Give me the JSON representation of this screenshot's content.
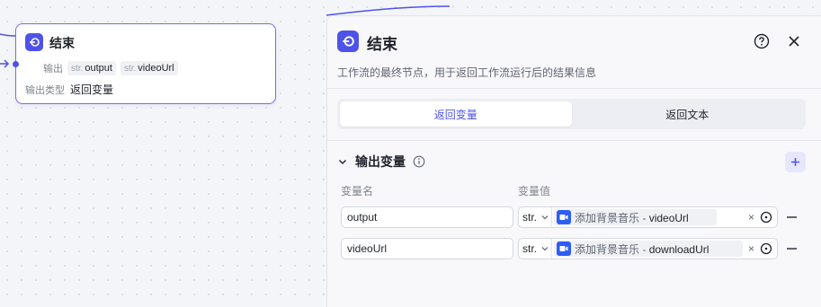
{
  "node": {
    "title": "结束",
    "output_label": "输出",
    "vars": [
      {
        "type": "str.",
        "name": "output"
      },
      {
        "type": "str.",
        "name": "videoUrl"
      }
    ],
    "output_type_label": "输出类型",
    "output_type_value": "返回变量"
  },
  "panel": {
    "title": "结束",
    "description": "工作流的最终节点，用于返回工作流运行后的结果信息",
    "tabs": [
      "返回变量",
      "返回文本"
    ],
    "active_tab": "返回变量",
    "section_title": "输出变量",
    "col_name": "变量名",
    "col_value": "变量值",
    "rows": [
      {
        "name": "output",
        "type": "str.",
        "ref_node": "添加背景音乐",
        "ref_sep": " - ",
        "ref_var": "videoUrl"
      },
      {
        "name": "videoUrl",
        "type": "str.",
        "ref_node": "添加背景音乐",
        "ref_sep": " - ",
        "ref_var": "downloadUrl"
      }
    ]
  },
  "colors": {
    "accent": "#4d53e8",
    "ref_icon": "#2e5df5"
  },
  "icons": [
    "end-node-icon",
    "help-icon",
    "close-icon",
    "chevron-down-icon",
    "info-icon",
    "plus-icon",
    "video-icon",
    "clear-icon",
    "target-icon",
    "minus-icon"
  ]
}
